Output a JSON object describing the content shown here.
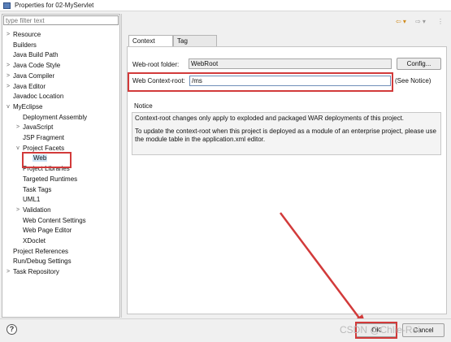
{
  "window": {
    "title": "Properties for 02-MyServlet"
  },
  "filter": {
    "placeholder": "type filter text"
  },
  "tree": [
    {
      "label": "Resource",
      "arrow": ">"
    },
    {
      "label": "Builders"
    },
    {
      "label": "Java Build Path"
    },
    {
      "label": "Java Code Style",
      "arrow": ">"
    },
    {
      "label": "Java Compiler",
      "arrow": ">"
    },
    {
      "label": "Java Editor",
      "arrow": ">"
    },
    {
      "label": "Javadoc Location"
    },
    {
      "label": "MyEclipse",
      "arrow": "v"
    },
    {
      "label": "Deployment Assembly"
    },
    {
      "label": "JavaScript",
      "arrow": ">"
    },
    {
      "label": "JSP Fragment"
    },
    {
      "label": "Project Facets",
      "arrow": "v"
    },
    {
      "label": "Web",
      "selected": true
    },
    {
      "label": "Project Libraries"
    },
    {
      "label": "Targeted Runtimes"
    },
    {
      "label": "Task Tags"
    },
    {
      "label": "UML1"
    },
    {
      "label": "Validation",
      "arrow": ">"
    },
    {
      "label": "Web Content Settings"
    },
    {
      "label": "Web Page Editor"
    },
    {
      "label": "XDoclet"
    },
    {
      "label": "Project References"
    },
    {
      "label": "Run/Debug Settings"
    },
    {
      "label": "Task Repository",
      "arrow": ">"
    }
  ],
  "tabs": [
    {
      "label": "Context Root",
      "active": true
    },
    {
      "label": "Tag Libraries"
    }
  ],
  "form": {
    "webroot_label": "Web-root folder:",
    "webroot_value": "WebRoot",
    "config_button": "Config...",
    "context_label": "Web Context-root:",
    "context_value": "/ms",
    "see_notice": "(See Notice)"
  },
  "notice": {
    "title": "Notice",
    "line1": "Context-root changes only apply to exploded and packaged WAR deployments of this project.",
    "line2": "To update the context-root when this project is deployed as a module of an enterprise project, please use the module table in the application.xml editor."
  },
  "footer": {
    "help": "?",
    "ok": "OK",
    "cancel": "Cancel",
    "watermark": "CSDN @Chlie-Rei"
  },
  "colors": {
    "annotation": "#d23a3a",
    "selection": "#cde4f7"
  }
}
